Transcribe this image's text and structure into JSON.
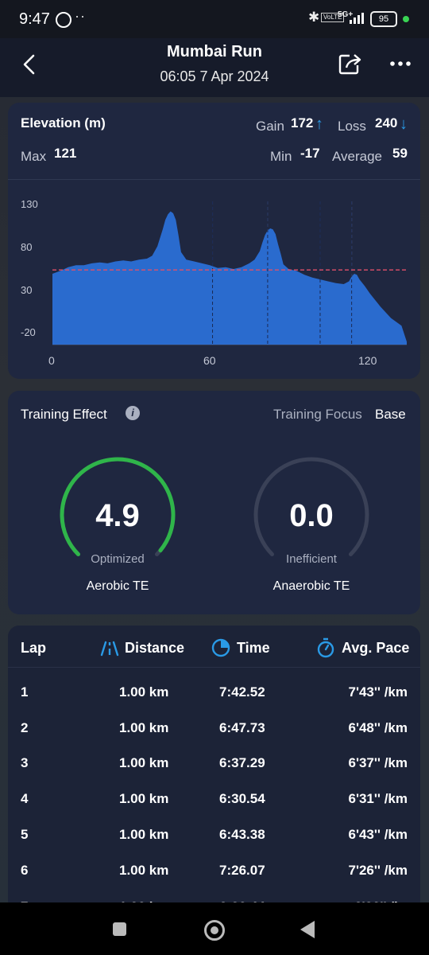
{
  "status_bar": {
    "time": "9:47",
    "dots": "··",
    "network": "5G+",
    "volte": "VoLTE",
    "battery": "95"
  },
  "header": {
    "title": "Mumbai Run",
    "subtitle": "06:05 7 Apr 2024"
  },
  "elevation": {
    "title": "Elevation (m)",
    "gain_label": "Gain",
    "gain_value": "172",
    "gain_arrow": "↑",
    "loss_label": "Loss",
    "loss_value": "240",
    "loss_arrow": "↓",
    "max_label": "Max",
    "max_value": "121",
    "min_label": "Min",
    "min_value": "-17",
    "average_label": "Average",
    "average_value": "59",
    "y_ticks": [
      "130",
      "80",
      "30",
      "-20"
    ],
    "x_ticks": [
      "0",
      "60",
      "120"
    ],
    "colors": {
      "fill": "#2b6fd6",
      "average_line": "#e0506a"
    }
  },
  "chart_data": {
    "type": "area",
    "xlabel": "",
    "ylabel": "",
    "xlim": [
      0,
      135
    ],
    "ylim": [
      -20,
      135
    ],
    "average": 59,
    "series": [
      {
        "values": [
          [
            0,
            55
          ],
          [
            3,
            58
          ],
          [
            6,
            62
          ],
          [
            9,
            64
          ],
          [
            12,
            64
          ],
          [
            15,
            66
          ],
          [
            18,
            67
          ],
          [
            21,
            66
          ],
          [
            24,
            68
          ],
          [
            27,
            69
          ],
          [
            30,
            68
          ],
          [
            33,
            70
          ],
          [
            36,
            71
          ],
          [
            38,
            74
          ],
          [
            40,
            84
          ],
          [
            42,
            102
          ],
          [
            43,
            112
          ],
          [
            44,
            118
          ],
          [
            45,
            121
          ],
          [
            46,
            119
          ],
          [
            47,
            112
          ],
          [
            48,
            96
          ],
          [
            49,
            78
          ],
          [
            51,
            70
          ],
          [
            54,
            68
          ],
          [
            57,
            66
          ],
          [
            60,
            64
          ],
          [
            63,
            61
          ],
          [
            66,
            62
          ],
          [
            69,
            60
          ],
          [
            72,
            62
          ],
          [
            75,
            66
          ],
          [
            77,
            70
          ],
          [
            79,
            79
          ],
          [
            80,
            88
          ],
          [
            81,
            96
          ],
          [
            82,
            101
          ],
          [
            83,
            103
          ],
          [
            84,
            102
          ],
          [
            85,
            97
          ],
          [
            86,
            86
          ],
          [
            87,
            76
          ],
          [
            88,
            65
          ],
          [
            90,
            60
          ],
          [
            93,
            58
          ],
          [
            96,
            54
          ],
          [
            99,
            51
          ],
          [
            102,
            49
          ],
          [
            105,
            47
          ],
          [
            108,
            45
          ],
          [
            111,
            44
          ],
          [
            113,
            47
          ],
          [
            114,
            52
          ],
          [
            115,
            55
          ],
          [
            116,
            54
          ],
          [
            117,
            49
          ],
          [
            119,
            42
          ],
          [
            121,
            34
          ],
          [
            123,
            27
          ],
          [
            125,
            20
          ],
          [
            127,
            14
          ],
          [
            129,
            8
          ],
          [
            131,
            4
          ],
          [
            133,
            0
          ],
          [
            135,
            -17
          ]
        ]
      }
    ]
  },
  "training": {
    "title": "Training Effect",
    "info_icon": "info-icon",
    "focus_label": "Training Focus",
    "focus_value": "Base",
    "aerobic": {
      "value": "4.9",
      "status": "Optimized",
      "label": "Aerobic TE",
      "fraction": 0.98,
      "color": "#2fb54a"
    },
    "anaerobic": {
      "value": "0.0",
      "status": "Inefficient",
      "label": "Anaerobic TE",
      "fraction": 0.0,
      "color": "#3a4157"
    }
  },
  "laps": {
    "headers": {
      "lap": "Lap",
      "distance": "Distance",
      "time": "Time",
      "pace": "Avg. Pace"
    },
    "icon_color": "#2a9ae6",
    "rows": [
      {
        "lap": "1",
        "distance": "1.00 km",
        "time": "7:42.52",
        "pace": "7'43'' /km"
      },
      {
        "lap": "2",
        "distance": "1.00 km",
        "time": "6:47.73",
        "pace": "6'48'' /km"
      },
      {
        "lap": "3",
        "distance": "1.00 km",
        "time": "6:37.29",
        "pace": "6'37'' /km"
      },
      {
        "lap": "4",
        "distance": "1.00 km",
        "time": "6:30.54",
        "pace": "6'31'' /km"
      },
      {
        "lap": "5",
        "distance": "1.00 km",
        "time": "6:43.38",
        "pace": "6'43'' /km"
      },
      {
        "lap": "6",
        "distance": "1.00 km",
        "time": "7:26.07",
        "pace": "7'26'' /km"
      }
    ]
  }
}
